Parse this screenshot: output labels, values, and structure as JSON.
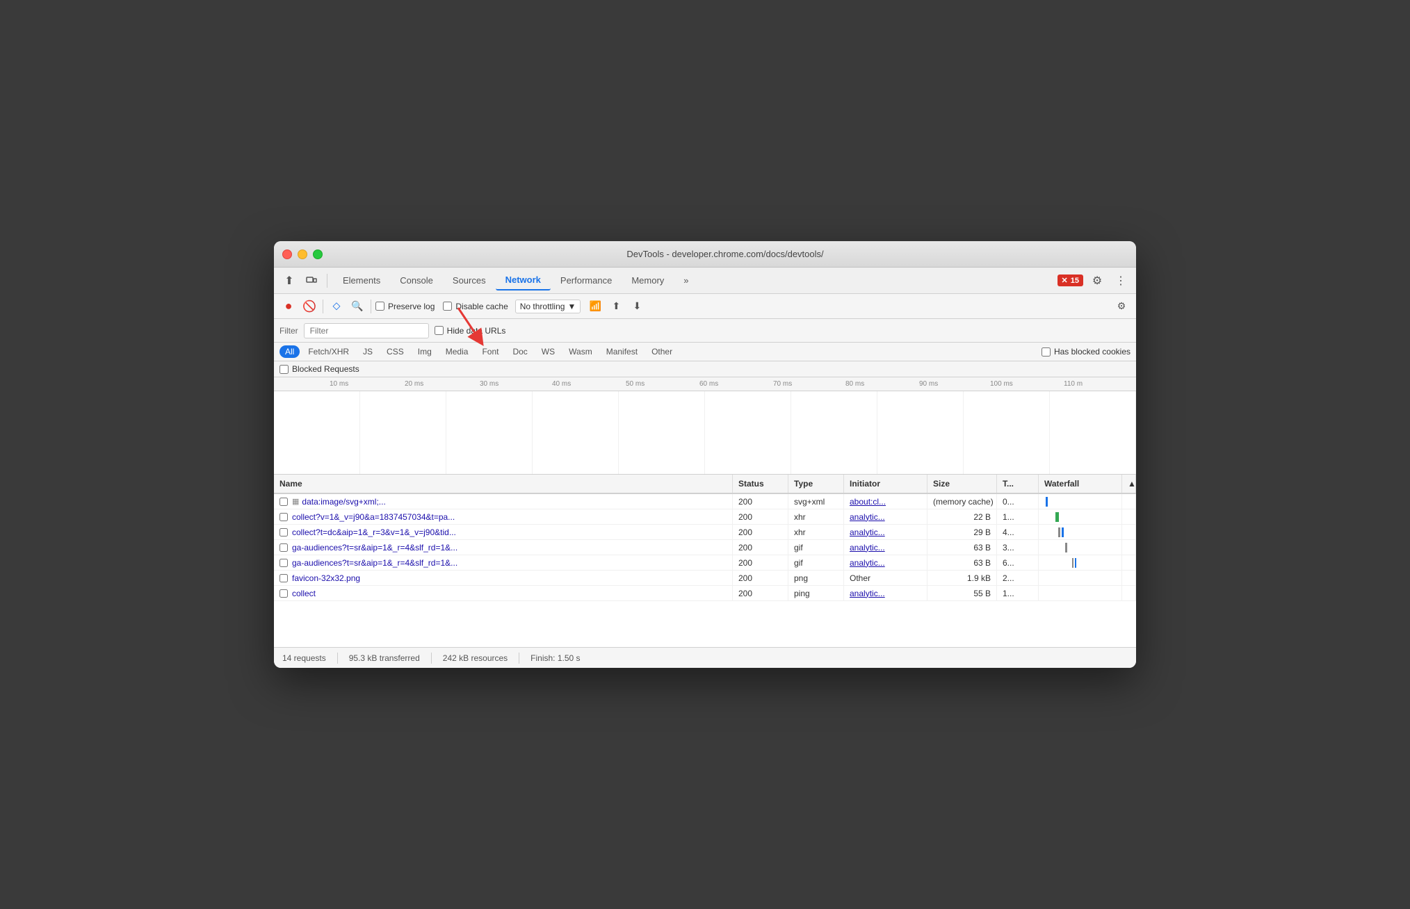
{
  "window": {
    "title": "DevTools - developer.chrome.com/docs/devtools/"
  },
  "nav": {
    "tabs": [
      "Elements",
      "Console",
      "Sources",
      "Network",
      "Performance",
      "Memory"
    ],
    "active_tab": "Network",
    "more_label": "»",
    "error_count": "15"
  },
  "toolbar": {
    "preserve_log_label": "Preserve log",
    "disable_cache_label": "Disable cache",
    "throttle_label": "No throttling",
    "throttle_arrow": "▼"
  },
  "filter": {
    "label": "Filter",
    "hide_data_urls_label": "Hide data URLs"
  },
  "filter_types": {
    "buttons": [
      "All",
      "Fetch/XHR",
      "JS",
      "CSS",
      "Img",
      "Media",
      "Font",
      "Doc",
      "WS",
      "Wasm",
      "Manifest",
      "Other"
    ],
    "active": "All",
    "has_blocked_cookies_label": "Has blocked cookies",
    "blocked_requests_label": "Blocked Requests"
  },
  "timeline": {
    "ticks": [
      "10 ms",
      "20 ms",
      "30 ms",
      "40 ms",
      "50 ms",
      "60 ms",
      "70 ms",
      "80 ms",
      "90 ms",
      "100 ms",
      "110 m"
    ]
  },
  "table": {
    "headers": [
      "Name",
      "Status",
      "Type",
      "Initiator",
      "Size",
      "T...",
      "Waterfall",
      ""
    ],
    "rows": [
      {
        "name": "data:image/svg+xml;...",
        "status": "200",
        "type": "svg+xml",
        "initiator": "about:cl...",
        "size": "(memory cache)",
        "time": "0...",
        "waterfall_type": "blue",
        "has_icon": true
      },
      {
        "name": "collect?v=1&_v=j90&a=1837457034&t=pa...",
        "status": "200",
        "type": "xhr",
        "initiator": "analytic...",
        "size": "22 B",
        "time": "1...",
        "waterfall_type": "green"
      },
      {
        "name": "collect?t=dc&aip=1&_r=3&v=1&_v=j90&tid...",
        "status": "200",
        "type": "xhr",
        "initiator": "analytic...",
        "size": "29 B",
        "time": "4...",
        "waterfall_type": "gray_double"
      },
      {
        "name": "ga-audiences?t=sr&aip=1&_r=4&slf_rd=1&...",
        "status": "200",
        "type": "gif",
        "initiator": "analytic...",
        "size": "63 B",
        "time": "3...",
        "waterfall_type": "gray"
      },
      {
        "name": "ga-audiences?t=sr&aip=1&_r=4&slf_rd=1&...",
        "status": "200",
        "type": "gif",
        "initiator": "analytic...",
        "size": "63 B",
        "time": "6...",
        "waterfall_type": "gray_double2"
      },
      {
        "name": "favicon-32x32.png",
        "status": "200",
        "type": "png",
        "initiator": "Other",
        "size": "1.9 kB",
        "time": "2...",
        "waterfall_type": "none"
      },
      {
        "name": "collect",
        "status": "200",
        "type": "ping",
        "initiator": "analytic...",
        "size": "55 B",
        "time": "1...",
        "waterfall_type": "none"
      }
    ]
  },
  "status_bar": {
    "requests": "14 requests",
    "transferred": "95.3 kB transferred",
    "resources": "242 kB resources",
    "finish": "Finish: 1.50 s"
  }
}
